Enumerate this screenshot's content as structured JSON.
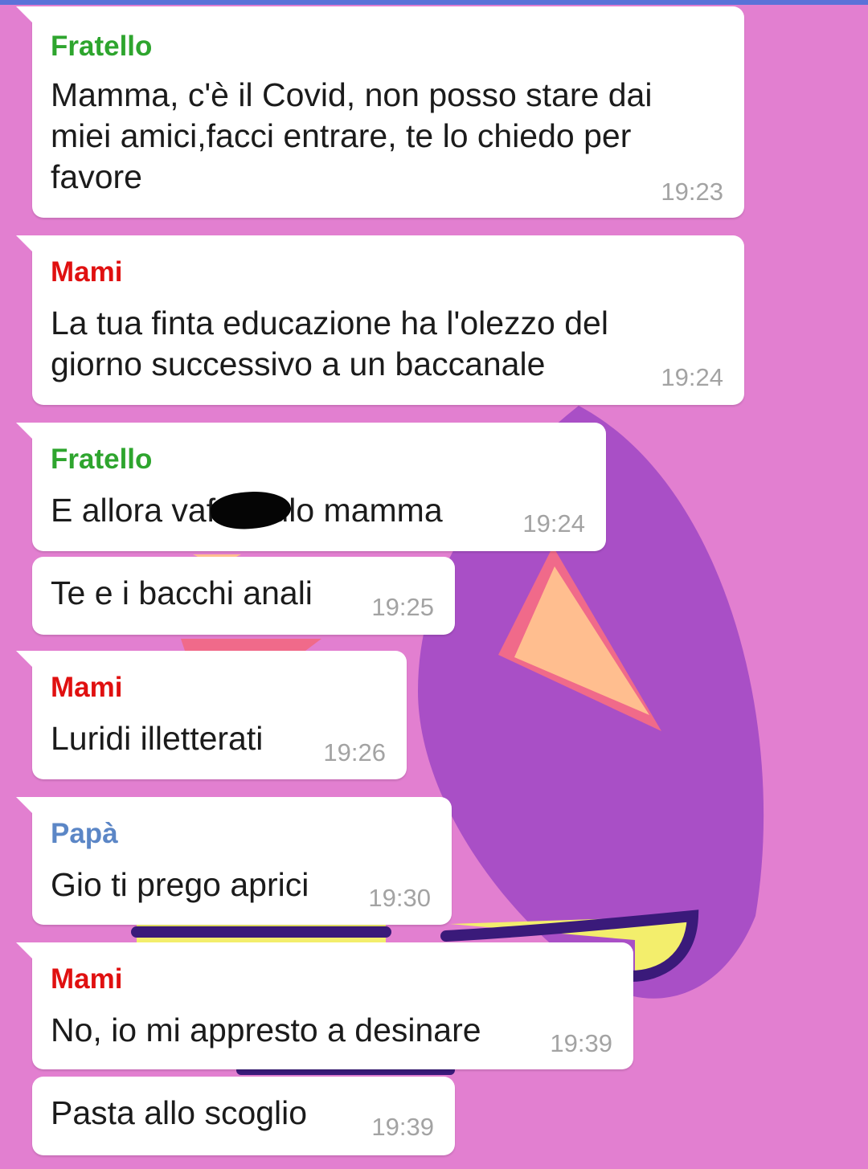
{
  "colors": {
    "background": "#e27fd0",
    "fratello": "#2ea52e",
    "mami": "#e01010",
    "papa": "#5b86c6",
    "timestamp": "#a3a3a3"
  },
  "messages": [
    {
      "sender": "Fratello",
      "text": "Mamma, c'è il Covid, non posso stare dai\nmiei amici,facci entrare, te lo chiedo per\nfavore",
      "time": "19:23"
    },
    {
      "sender": "Mami",
      "text": "La tua finta educazione ha l'olezzo del\ngiorno successivo a un baccanale",
      "time": "19:24"
    },
    {
      "sender": "Fratello",
      "text": "E allora vaf      ulo mamma",
      "time": "19:24"
    },
    {
      "sender": "",
      "text": "Te e i bacchi anali",
      "time": "19:25"
    },
    {
      "sender": "Mami",
      "text": "Luridi illetterati",
      "time": "19:26"
    },
    {
      "sender": "Papà",
      "text": "Gio ti prego aprici",
      "time": "19:30"
    },
    {
      "sender": "Mami",
      "text": "No, io mi appresto a desinare",
      "time": "19:39"
    },
    {
      "sender": "",
      "text": "Pasta allo scoglio",
      "time": "19:39"
    }
  ]
}
